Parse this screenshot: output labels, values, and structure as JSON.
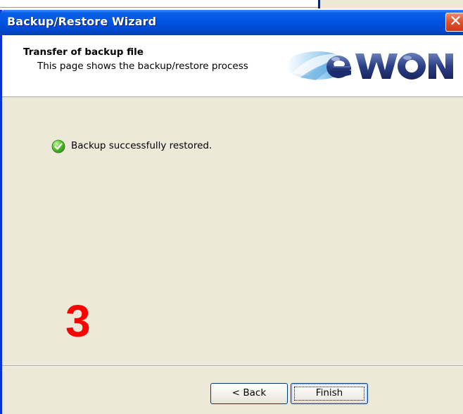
{
  "window": {
    "title": "Backup/Restore Wizard",
    "close_glyph": "✕"
  },
  "header": {
    "title": "Transfer of backup file",
    "subtitle": "This page shows the backup/restore process",
    "logo_text": "eWON",
    "logo_icon": "ewon-logo"
  },
  "content": {
    "status_icon": "check-circle-icon",
    "status_text": "Backup successfully restored.",
    "step_number": "3"
  },
  "buttons": {
    "back_label": "< Back",
    "finish_label": "Finish"
  },
  "colors": {
    "titlebar": "#0054e3",
    "dialog_bg": "#ece9d8",
    "close_button": "#e0552d",
    "step_number": "#ff0000",
    "success_icon": "#3aa61e"
  }
}
